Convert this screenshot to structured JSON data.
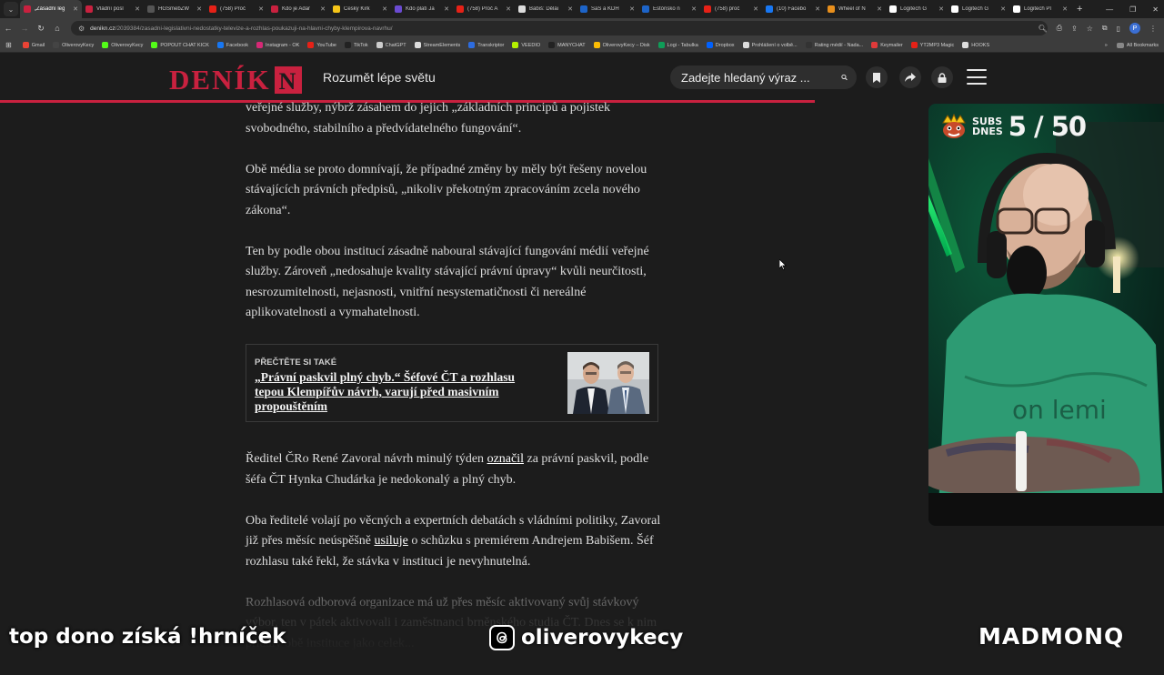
{
  "browser": {
    "tabs": [
      {
        "label": "„Zásadní leg",
        "color": "#c9213f",
        "active": true
      },
      {
        "label": "Vládní posl",
        "color": "#c9213f"
      },
      {
        "label": "HGSmebZW",
        "color": "#555555"
      },
      {
        "label": "(758) Proč",
        "color": "#e62117"
      },
      {
        "label": "Kdo je Adar",
        "color": "#c9213f"
      },
      {
        "label": "Český Kirk",
        "color": "#f5c518"
      },
      {
        "label": "Kdo platí Ja",
        "color": "#6b4bd1"
      },
      {
        "label": "(758) Proč A",
        "color": "#e62117"
      },
      {
        "label": "Babiš: Děláı",
        "color": "#dddddd"
      },
      {
        "label": "SaS a KDH",
        "color": "#1d64c8"
      },
      {
        "label": "Estónsko n",
        "color": "#1d64c8"
      },
      {
        "label": "(758) proč",
        "color": "#e62117"
      },
      {
        "label": "(10) Facebo",
        "color": "#1877f2"
      },
      {
        "label": "Wheel of N",
        "color": "#e88f1c"
      },
      {
        "label": "Logitech G",
        "color": "#ffffff"
      },
      {
        "label": "Logitech G",
        "color": "#ffffff"
      },
      {
        "label": "Logitech PI",
        "color": "#ffffff"
      }
    ],
    "url_host": "denikn.cz",
    "url_path": "/2039384/zasadni-legislativni-nedostatky-televize-a-rozhlas-poukazuji-na-hlavni-chyby-klempirova-navrhu/",
    "bookmarks": [
      {
        "label": "Gmail",
        "color": "#ea4335"
      },
      {
        "label": "OliverovyKecy",
        "color": "#444444"
      },
      {
        "label": "OliverovyKecy",
        "color": "#53fc18"
      },
      {
        "label": "POPOUT CHAT KICK",
        "color": "#53fc18"
      },
      {
        "label": "Facebook",
        "color": "#1877f2"
      },
      {
        "label": "Instagram - OK",
        "color": "#d62976"
      },
      {
        "label": "YouTube",
        "color": "#e62117"
      },
      {
        "label": "TikTok",
        "color": "#222222"
      },
      {
        "label": "ChatGPT",
        "color": "#cccccc"
      },
      {
        "label": "StreamElements",
        "color": "#dddddd"
      },
      {
        "label": "Transkriptor",
        "color": "#2d6cdf"
      },
      {
        "label": "VEEDIO",
        "color": "#b4f000"
      },
      {
        "label": "MANYCHAT",
        "color": "#222222"
      },
      {
        "label": "OliverovyKecy – Disk",
        "color": "#fbbc04"
      },
      {
        "label": "Logi - Tabulka",
        "color": "#0f9d58"
      },
      {
        "label": "Dropbox",
        "color": "#0061ff"
      },
      {
        "label": "Prohlášení o volbě...",
        "color": "#dddddd"
      },
      {
        "label": "Rating médií - Nada...",
        "color": "#333333"
      },
      {
        "label": "Keymailer",
        "color": "#e03a3a"
      },
      {
        "label": "YT2MP3 Magic",
        "color": "#e62117"
      },
      {
        "label": "HOOKS",
        "color": "#dddddd"
      }
    ],
    "all_bookmarks": "All Bookmarks",
    "profile_initial": "P"
  },
  "site": {
    "logo_text": "DENÍK",
    "logo_letter": "N",
    "tagline": "Rozumět lépe světu",
    "search_placeholder": "Zadejte hledaný výraz ...",
    "accent": "#c9213f",
    "reading_progress": 0.7
  },
  "article": {
    "p1": "veřejné služby, nýbrž zásahem do jejich „základních principů a pojistek svobodného, stabilního a předvídatelného fungování“.",
    "p2": "Obě média se proto domnívají, že případné změny by měly být řešeny novelou stávajících právních předpisů, „nikoliv překotným zpracováním zcela nového zákona“.",
    "p3": "Ten by podle obou institucí zásadně naboural stávající fungování médií veřejné služby. Zároveň „nedosahuje kvality stávající právní úpravy“ kvůli neurčitosti, nesrozumitelnosti, nejasnosti, vnitřní nesystematičnosti či nereálné aplikovatelnosti a vymahatelnosti.",
    "read_also_kicker": "PŘEČTĚTE SI TAKÉ",
    "read_also_title": "„Právní paskvil plný chyb.“ Šéfové ČT a rozhlasu tepou Klempířův návrh, varují před masivním propouštěním",
    "p4_before": "Ředitel ČRo René Zavoral návrh minulý týden ",
    "p4_link": "označil",
    "p4_after": " za právní paskvil, podle šéfa ČT Hynka Chudárka je nedokonalý a plný chyb.",
    "p5_before": "Oba ředitelé volají po věcných a expertních debatách s vládními politiky, Zavoral již přes měsíc neúspěšně ",
    "p5_link": "usiluje",
    "p5_after": " o schůzku s premiérem Andrejem Babišem. Šéf rozhlasu také řekl, že stávka v instituci je nevyhnutelná.",
    "p6": "Rozhlasová odborová organizace má už přes měsíc aktivovaný svůj stávkový výbor, ten v pátek aktivovali i zaměstnanci brněnského studia ČT. Dnes se k nim přidaly obě instituce jako celek..."
  },
  "webcam": {
    "subs_label_1": "SUBS",
    "subs_label_2": "DNES",
    "subs_count": "5 / 50"
  },
  "overlay": {
    "left_text": "top dono získá !hrníček",
    "mid_text": "oliverovykecy",
    "right_text": "MADMONQ"
  }
}
